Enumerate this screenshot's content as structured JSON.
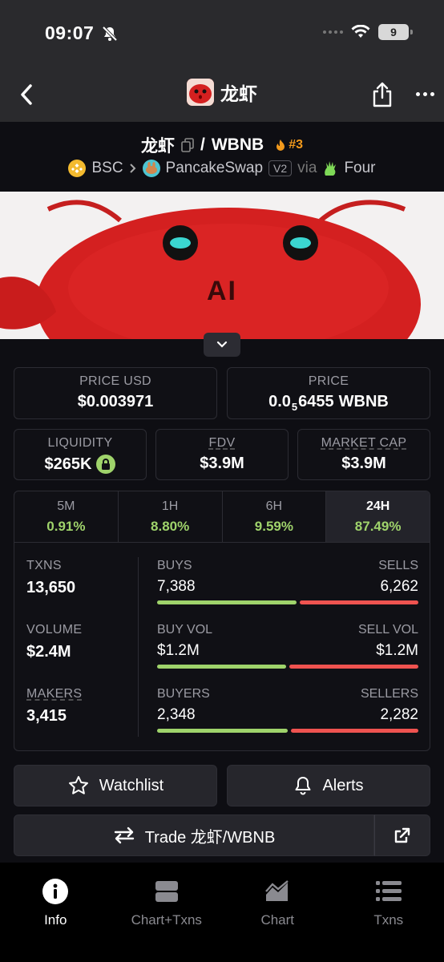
{
  "status": {
    "time": "09:07",
    "battery": "9"
  },
  "nav": {
    "title": "龙虾"
  },
  "pair": {
    "base": "龙虾",
    "separator": "/",
    "quote": "WBNB",
    "rank": "#3",
    "chain": "BSC",
    "dex": "PancakeSwap",
    "version": "V2",
    "via": "via",
    "launchpad": "Four"
  },
  "banner": {
    "text": "AI"
  },
  "stats": {
    "price_usd": {
      "label": "PRICE USD",
      "value": "$0.003971"
    },
    "price_native": {
      "label": "PRICE",
      "prefix": "0.0",
      "subscript": "5",
      "digits": "6455",
      "unit": "WBNB"
    },
    "liquidity": {
      "label": "LIQUIDITY",
      "value": "$265K"
    },
    "fdv": {
      "label": "FDV",
      "value": "$3.9M"
    },
    "market_cap": {
      "label": "MARKET CAP",
      "value": "$3.9M"
    }
  },
  "timeframes": [
    {
      "label": "5M",
      "value": "0.91%"
    },
    {
      "label": "1H",
      "value": "8.80%"
    },
    {
      "label": "6H",
      "value": "9.59%"
    },
    {
      "label": "24H",
      "value": "87.49%"
    }
  ],
  "activity": {
    "txns": {
      "label": "TXNS",
      "value": "13,650"
    },
    "volume": {
      "label": "VOLUME",
      "value": "$2.4M"
    },
    "makers": {
      "label": "MAKERS",
      "value": "3,415"
    },
    "buys": {
      "label": "BUYS",
      "value": "7,388"
    },
    "sells": {
      "label": "SELLS",
      "value": "6,262"
    },
    "buy_vol": {
      "label": "BUY VOL",
      "value": "$1.2M"
    },
    "sell_vol": {
      "label": "SELL VOL",
      "value": "$1.2M"
    },
    "buyers": {
      "label": "BUYERS",
      "value": "2,348"
    },
    "sellers": {
      "label": "SELLERS",
      "value": "2,282"
    },
    "buy_share": {
      "txns": 0.541,
      "volume": 0.5,
      "makers": 0.507
    }
  },
  "actions": {
    "watchlist": "Watchlist",
    "alerts": "Alerts",
    "trade": "Trade 龙虾/WBNB"
  },
  "tabs": [
    {
      "label": "Info",
      "icon": "info-icon"
    },
    {
      "label": "Chart+Txns",
      "icon": "split-icon"
    },
    {
      "label": "Chart",
      "icon": "area-chart-icon"
    },
    {
      "label": "Txns",
      "icon": "list-icon"
    }
  ],
  "colors": {
    "positive": "#9fd36b",
    "negative": "#ef5350",
    "rank": "#f39a1c"
  }
}
